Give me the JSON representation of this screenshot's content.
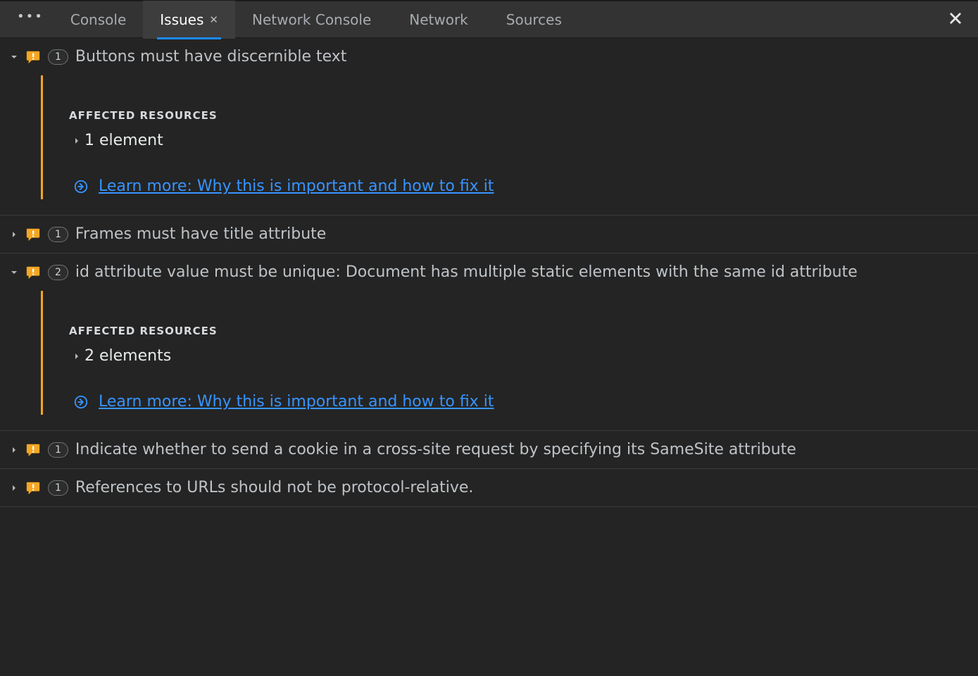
{
  "tabs": {
    "console": "Console",
    "issues": "Issues",
    "network_console": "Network Console",
    "network": "Network",
    "sources": "Sources"
  },
  "section_label": "AFFECTED RESOURCES",
  "learn_more_label": "Learn more: Why this is important and how to fix it",
  "issues": [
    {
      "count": "1",
      "title": "Buttons must have discernible text",
      "expanded": true,
      "elements_label": "1 element"
    },
    {
      "count": "1",
      "title": "Frames must have title attribute",
      "expanded": false
    },
    {
      "count": "2",
      "title": "id attribute value must be unique: Document has multiple static elements with the same id attribute",
      "expanded": true,
      "elements_label": "2 elements"
    },
    {
      "count": "1",
      "title": "Indicate whether to send a cookie in a cross-site request by specifying its SameSite attribute",
      "expanded": false
    },
    {
      "count": "1",
      "title": "References to URLs should not be protocol-relative.",
      "expanded": false
    }
  ]
}
